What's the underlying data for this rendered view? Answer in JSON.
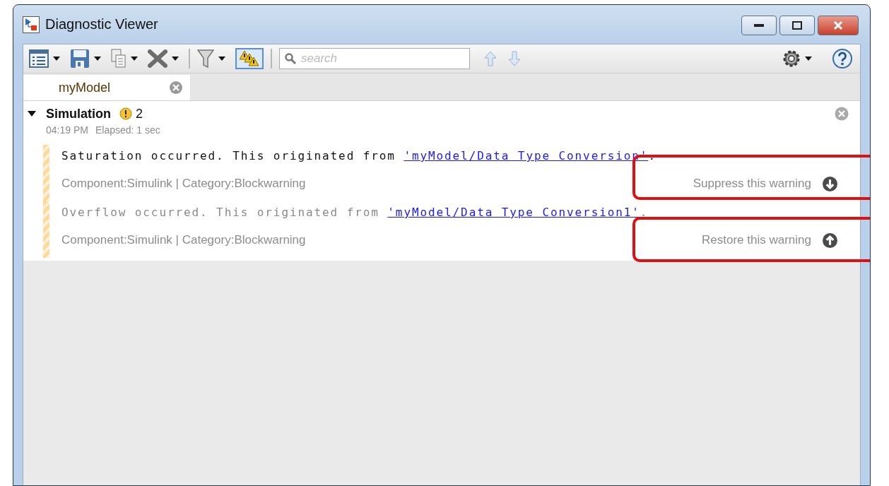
{
  "window": {
    "title": "Diagnostic Viewer"
  },
  "toolbar": {
    "search": {
      "placeholder": "search"
    },
    "warnings_toggle": {
      "on": true
    }
  },
  "tabs": [
    {
      "label": "myModel",
      "selected": true
    }
  ],
  "group": {
    "title": "Simulation",
    "expanded": true,
    "warning_count": "2",
    "time": "04:19 PM",
    "elapsed": "Elapsed: 1 sec",
    "messages": [
      {
        "text": "Saturation occurred. This originated from ",
        "link": "'myModel/Data Type Conversion'",
        "end": ".",
        "info": "Component:Simulink | Category:Blockwarning",
        "action": "Suppress this warning",
        "kind": "suppress",
        "suppressed": false,
        "highlighted": true
      },
      {
        "text": "Overflow occurred. This originated from ",
        "link": "'myModel/Data Type Conversion1'",
        "end": ".",
        "info": "Component:Simulink | Category:Blockwarning",
        "action": "Restore this warning",
        "kind": "restore",
        "suppressed": true,
        "highlighted": true
      }
    ]
  }
}
